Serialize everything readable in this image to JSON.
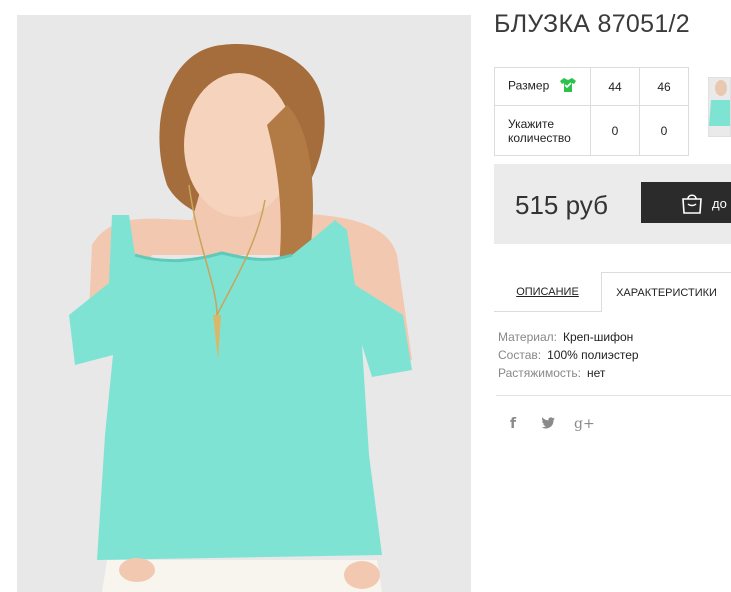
{
  "product": {
    "title": "БЛУЗКА 87051/2",
    "image_alt": "Женщина в бирюзовой блузке с открытыми плечами"
  },
  "size_table": {
    "size_label": "Размер",
    "qty_label": "Укажите количество",
    "sizes": [
      "44",
      "46"
    ],
    "quantities": [
      "0",
      "0"
    ]
  },
  "purchase": {
    "price": "515 руб",
    "cart_label": "до"
  },
  "tabs": {
    "description": "ОПИСАНИЕ",
    "characteristics": "ХАРАКТЕРИСТИКИ"
  },
  "specs": [
    {
      "label": "Материал:",
      "value": "Креп-шифон"
    },
    {
      "label": "Состав:",
      "value": "100% полиэстер"
    },
    {
      "label": "Растяжимость:",
      "value": "нет"
    }
  ],
  "social": {
    "facebook": "f",
    "twitter": "t",
    "googleplus": "g+"
  },
  "colors": {
    "blouse": "#7fe3d4",
    "price_bg": "#ebebeb",
    "button_bg": "#2b2b2b",
    "size_icon": "#2bc24a"
  }
}
